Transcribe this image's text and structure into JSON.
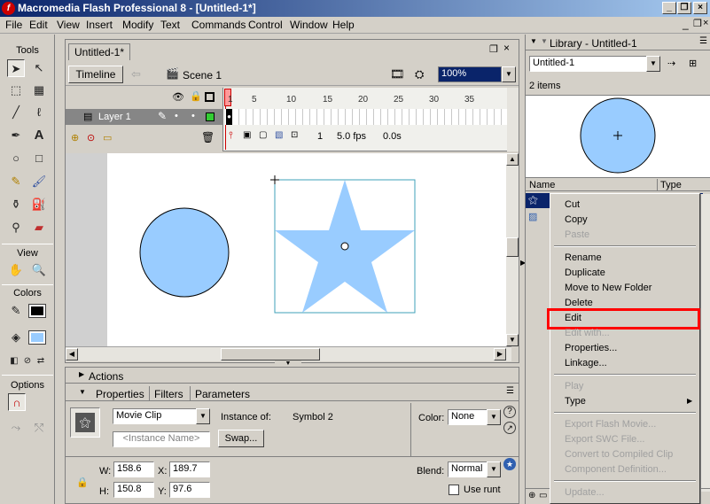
{
  "window": {
    "title": "Macromedia Flash Professional 8 - [Untitled-1*]",
    "app_icon": "f"
  },
  "menu": [
    "File",
    "Edit",
    "View",
    "Insert",
    "Modify",
    "Text",
    "Commands",
    "Control",
    "Window",
    "Help"
  ],
  "tools": {
    "title": "Tools",
    "view_label": "View",
    "colors_label": "Colors",
    "options_label": "Options",
    "stroke_color": "#000000",
    "fill_color": "#99ccff"
  },
  "document": {
    "tab": "Untitled-1*",
    "timeline_button": "Timeline",
    "scene": "Scene 1",
    "zoom": "100%",
    "layer_name": "Layer 1",
    "frame_numbers": [
      "1",
      "5",
      "10",
      "15",
      "20",
      "25",
      "30",
      "35"
    ],
    "current_frame": "1",
    "fps": "5.0 fps",
    "time": "0.0s"
  },
  "panels": {
    "actions": "Actions",
    "tabs": [
      "Properties",
      "Filters",
      "Parameters"
    ],
    "symbol_type": "Movie Clip",
    "instance_name_placeholder": "<Instance Name>",
    "instance_of_label": "Instance of:",
    "instance_of": "Symbol 2",
    "swap_button": "Swap...",
    "color_label": "Color:",
    "color_value": "None",
    "w_label": "W:",
    "w": "158.6",
    "x_label": "X:",
    "x": "189.7",
    "h_label": "H:",
    "h": "150.8",
    "y_label": "Y:",
    "y": "97.6",
    "blend_label": "Blend:",
    "blend": "Normal",
    "use_runtime": "Use runt"
  },
  "library": {
    "title": "Library - Untitled-1",
    "document": "Untitled-1",
    "count": "2 items",
    "col_name": "Name",
    "col_type": "Type"
  },
  "context_menu": {
    "groups": [
      [
        {
          "label": "Cut",
          "enabled": true
        },
        {
          "label": "Copy",
          "enabled": true
        },
        {
          "label": "Paste",
          "enabled": false
        }
      ],
      [
        {
          "label": "Rename",
          "enabled": true
        },
        {
          "label": "Duplicate",
          "enabled": true
        },
        {
          "label": "Move to New Folder",
          "enabled": true
        },
        {
          "label": "Delete",
          "enabled": true
        },
        {
          "label": "Edit",
          "enabled": true,
          "highlighted": true
        },
        {
          "label": "Edit with...",
          "enabled": false
        },
        {
          "label": "Properties...",
          "enabled": true
        },
        {
          "label": "Linkage...",
          "enabled": true
        }
      ],
      [
        {
          "label": "Play",
          "enabled": false
        },
        {
          "label": "Type",
          "enabled": true,
          "submenu": true
        }
      ],
      [
        {
          "label": "Export Flash Movie...",
          "enabled": false
        },
        {
          "label": "Export SWC File...",
          "enabled": false
        },
        {
          "label": "Convert to Compiled Clip",
          "enabled": false
        },
        {
          "label": "Component Definition...",
          "enabled": false
        }
      ],
      [
        {
          "label": "Update...",
          "enabled": false
        }
      ]
    ],
    "highlight_color": "#ff0000"
  },
  "colors": {
    "shape_fill": "#99ccff",
    "titlebar": "#0a246a"
  }
}
